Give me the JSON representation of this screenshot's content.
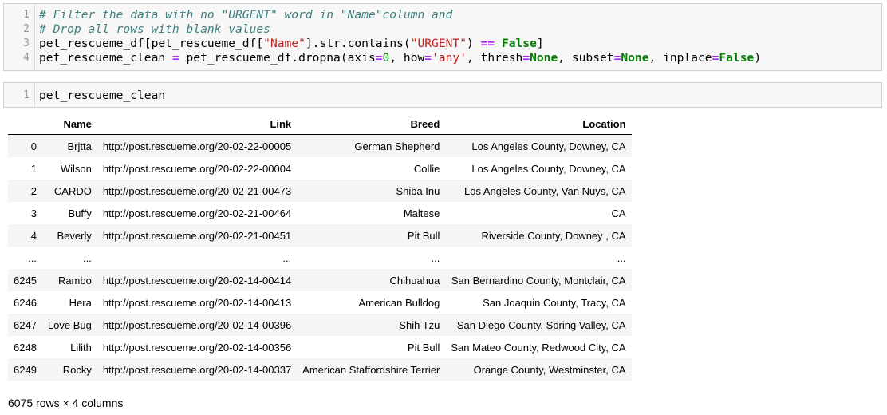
{
  "cell1": {
    "line_numbers": [
      "1",
      "2",
      "3",
      "4"
    ],
    "comment1": "# Filter the data with no \"URGENT\" word in \"Name\"column and",
    "comment2": "# Drop all rows with blank values",
    "l3_a": "pet_rescueme_df[pet_rescueme_df[",
    "l3_str1": "\"Name\"",
    "l3_b": "].str.contains(",
    "l3_str2": "\"URGENT\"",
    "l3_c": ") ",
    "l3_op": "==",
    "l3_d": " ",
    "l3_kw": "False",
    "l3_e": "]",
    "l4_a": "pet_rescueme_clean ",
    "l4_op1": "=",
    "l4_b": " pet_rescueme_df.dropna(axis",
    "l4_op2": "=",
    "l4_num": "0",
    "l4_c": ", how",
    "l4_op3": "=",
    "l4_str": "'any'",
    "l4_d": ", thresh",
    "l4_op4": "=",
    "l4_kw1": "None",
    "l4_e": ", subset",
    "l4_op5": "=",
    "l4_kw2": "None",
    "l4_f": ", inplace",
    "l4_op6": "=",
    "l4_kw3": "False",
    "l4_g": ")"
  },
  "cell2": {
    "line_number": "1",
    "code": "pet_rescueme_clean"
  },
  "dataframe": {
    "columns": [
      "",
      "Name",
      "Link",
      "Breed",
      "Location"
    ],
    "rows": [
      {
        "index": "0",
        "name": "Brjtta",
        "link": "http://post.rescueme.org/20-02-22-00005",
        "breed": "German Shepherd",
        "location": "Los Angeles County, Downey, CA"
      },
      {
        "index": "1",
        "name": "Wilson",
        "link": "http://post.rescueme.org/20-02-22-00004",
        "breed": "Collie",
        "location": "Los Angeles County, Downey, CA"
      },
      {
        "index": "2",
        "name": "CARDO",
        "link": "http://post.rescueme.org/20-02-21-00473",
        "breed": "Shiba Inu",
        "location": "Los Angeles County, Van Nuys, CA"
      },
      {
        "index": "3",
        "name": "Buffy",
        "link": "http://post.rescueme.org/20-02-21-00464",
        "breed": "Maltese",
        "location": "CA"
      },
      {
        "index": "4",
        "name": "Beverly",
        "link": "http://post.rescueme.org/20-02-21-00451",
        "breed": "Pit Bull",
        "location": "Riverside County, Downey , CA"
      },
      {
        "index": "...",
        "name": "...",
        "link": "...",
        "breed": "...",
        "location": "..."
      },
      {
        "index": "6245",
        "name": "Rambo",
        "link": "http://post.rescueme.org/20-02-14-00414",
        "breed": "Chihuahua",
        "location": "San Bernardino County, Montclair, CA"
      },
      {
        "index": "6246",
        "name": "Hera",
        "link": "http://post.rescueme.org/20-02-14-00413",
        "breed": "American Bulldog",
        "location": "San Joaquin County, Tracy, CA"
      },
      {
        "index": "6247",
        "name": "Love Bug",
        "link": "http://post.rescueme.org/20-02-14-00396",
        "breed": "Shih Tzu",
        "location": "San Diego County, Spring Valley, CA"
      },
      {
        "index": "6248",
        "name": "Lilith",
        "link": "http://post.rescueme.org/20-02-14-00356",
        "breed": "Pit Bull",
        "location": "San Mateo County, Redwood City, CA"
      },
      {
        "index": "6249",
        "name": "Rocky",
        "link": "http://post.rescueme.org/20-02-14-00337",
        "breed": "American Staffordshire Terrier",
        "location": "Orange County, Westminster, CA"
      }
    ],
    "shape_text": "6075 rows × 4 columns"
  }
}
